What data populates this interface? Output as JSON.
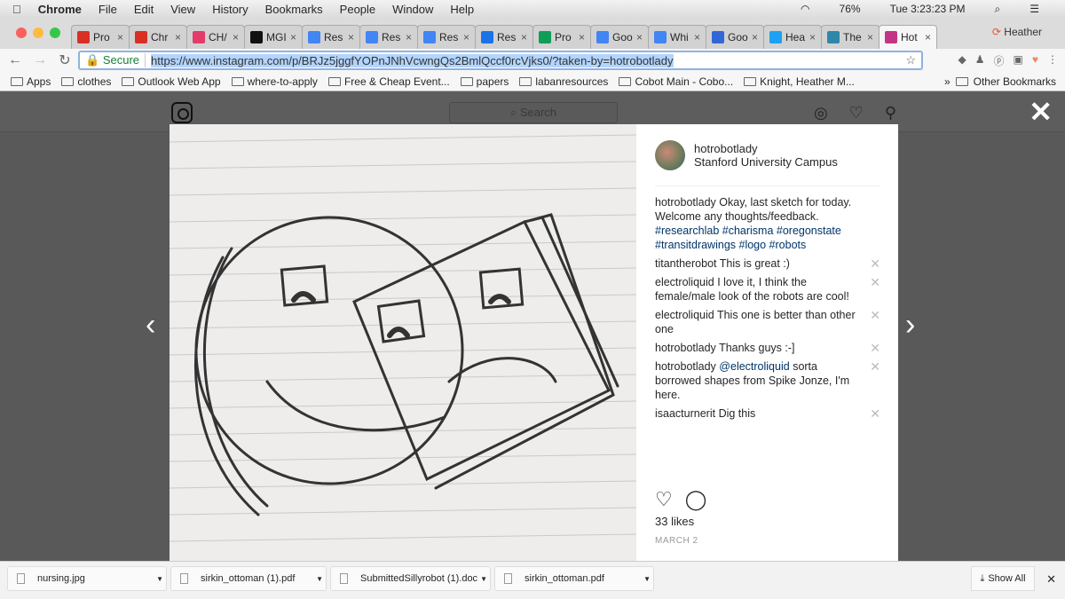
{
  "menubar": {
    "apple": "",
    "app": "Chrome",
    "items": [
      "File",
      "Edit",
      "View",
      "History",
      "Bookmarks",
      "People",
      "Window",
      "Help"
    ],
    "battery": "76%",
    "clock": "Tue 3:23:23 PM"
  },
  "tabs": [
    {
      "title": "Pro",
      "color": "#d93025"
    },
    {
      "title": "Chr",
      "color": "#d93025"
    },
    {
      "title": "CH/",
      "color": "#e33c6b"
    },
    {
      "title": "MGI",
      "color": "#111111"
    },
    {
      "title": "Res",
      "color": "#4285f4"
    },
    {
      "title": "Res",
      "color": "#4285f4"
    },
    {
      "title": "Res",
      "color": "#4285f4"
    },
    {
      "title": "Res",
      "color": "#1a73e8"
    },
    {
      "title": "Pro",
      "color": "#0f9d58"
    },
    {
      "title": "Goo",
      "color": "#4285f4"
    },
    {
      "title": "Whi",
      "color": "#4285f4"
    },
    {
      "title": "Goo",
      "color": "#3367d6"
    },
    {
      "title": "Hea",
      "color": "#1da1f2"
    },
    {
      "title": "The",
      "color": "#2e86ab"
    },
    {
      "title": "Hot",
      "color": "#c13584",
      "active": true
    }
  ],
  "profile": "Heather",
  "address": {
    "secure": "Secure",
    "url": "https://www.instagram.com/p/BRJz5jggfYOPnJNhVcwngQs2BmlQccf0rcVjks0/?taken-by=hotrobotlady"
  },
  "bookmarks": [
    "Apps",
    "clothes",
    "Outlook Web App",
    "where-to-apply",
    "Free & Cheap Event...",
    "papers",
    "labanresources",
    "Cobot Main - Cobo...",
    "Knight, Heather M..."
  ],
  "other_bookmarks": "Other Bookmarks",
  "instagram": {
    "search_placeholder": "Search"
  },
  "post": {
    "username": "hotrobotlady",
    "location": "Stanford University Campus",
    "caption": {
      "user": "hotrobotlady",
      "text": "Okay, last sketch for today. Welcome any thoughts/feedback.",
      "tags": "#researchlab #charisma #oregonstate #transitdrawings #logo #robots"
    },
    "comments": [
      {
        "user": "titantherobot",
        "text": "This is great :)"
      },
      {
        "user": "electroliquid",
        "text": "I love it, I think the female/male look of the robots are cool!"
      },
      {
        "user": "electroliquid",
        "text": "This one is better than other one"
      },
      {
        "user": "hotrobotlady",
        "text": "Thanks guys :-]"
      },
      {
        "user": "hotrobotlady",
        "mention": "@electroliquid",
        "text": "sorta borrowed shapes from Spike Jonze, I'm here."
      },
      {
        "user": "isaacturnerit",
        "text": "Dig this"
      }
    ],
    "likes": "33 likes",
    "date": "MARCH 2"
  },
  "downloads": [
    "nursing.jpg",
    "sirkin_ottoman (1).pdf",
    "SubmittedSillyrobot (1).doc",
    "sirkin_ottoman.pdf"
  ],
  "show_all": "Show All"
}
